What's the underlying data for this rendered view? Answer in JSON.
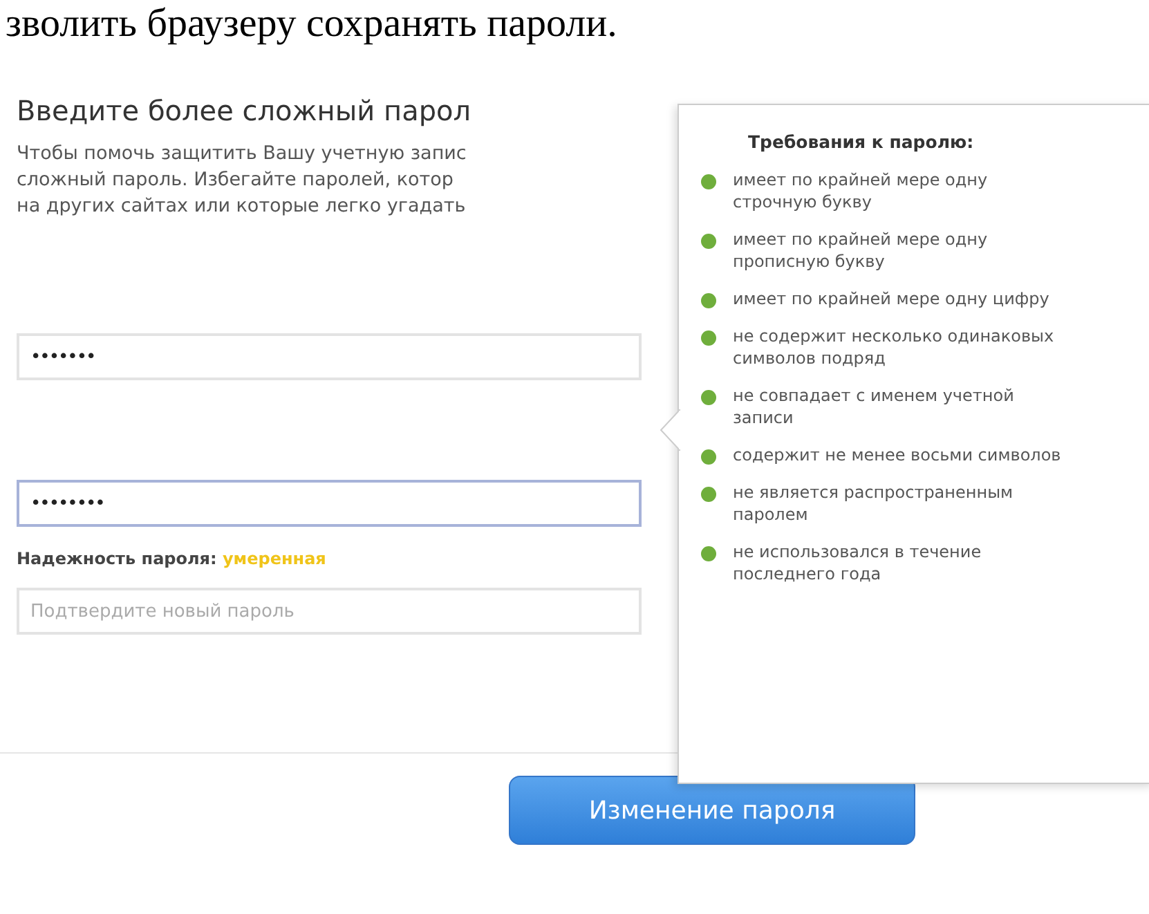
{
  "top_text": "зволить браузеру сохранять пароли.",
  "heading": "Введите более сложный парол",
  "intro_lines": [
    "Чтобы помочь защитить Вашу учетную запис",
    "сложный пароль. Избегайте паролей, котор",
    "на других сайтах или которые легко угадать"
  ],
  "new_password": {
    "value": "•••••••",
    "focused": false
  },
  "repeat_password": {
    "value": "••••••••",
    "focused": true
  },
  "strength": {
    "label": "Надежность пароля:",
    "value": "умеренная"
  },
  "confirm": {
    "placeholder": "Подтвердите новый пароль"
  },
  "requirements": {
    "title": "Требования к паролю:",
    "items": [
      {
        "text": "имеет по крайней мере одну строчную букву",
        "met": true
      },
      {
        "text": "имеет по крайней мере одну прописную букву",
        "met": true
      },
      {
        "text": "имеет по крайней мере одну цифру",
        "met": true
      },
      {
        "text": "не содержит несколько одинаковых символов подряд",
        "met": true
      },
      {
        "text": "не совпадает с именем учетной записи",
        "met": true
      },
      {
        "text": "содержит не менее восьми символов",
        "met": true
      },
      {
        "text": "не является распространенным паролем",
        "met": true
      },
      {
        "text": "не использовался в течение последнего года",
        "met": true
      }
    ]
  },
  "submit": "Изменение пароля"
}
